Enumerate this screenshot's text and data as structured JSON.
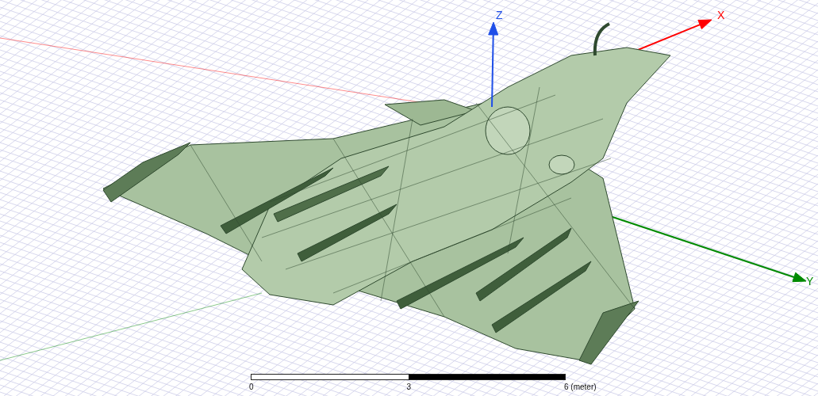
{
  "axes": [
    {
      "label": "Z",
      "color": "#1f4fe8"
    },
    {
      "label": "X",
      "color": "#ff0000"
    },
    {
      "label": "Y",
      "color": "#008a00"
    }
  ],
  "scale_bar": {
    "ticks": [
      "0",
      "3",
      "6 (meter)"
    ]
  }
}
